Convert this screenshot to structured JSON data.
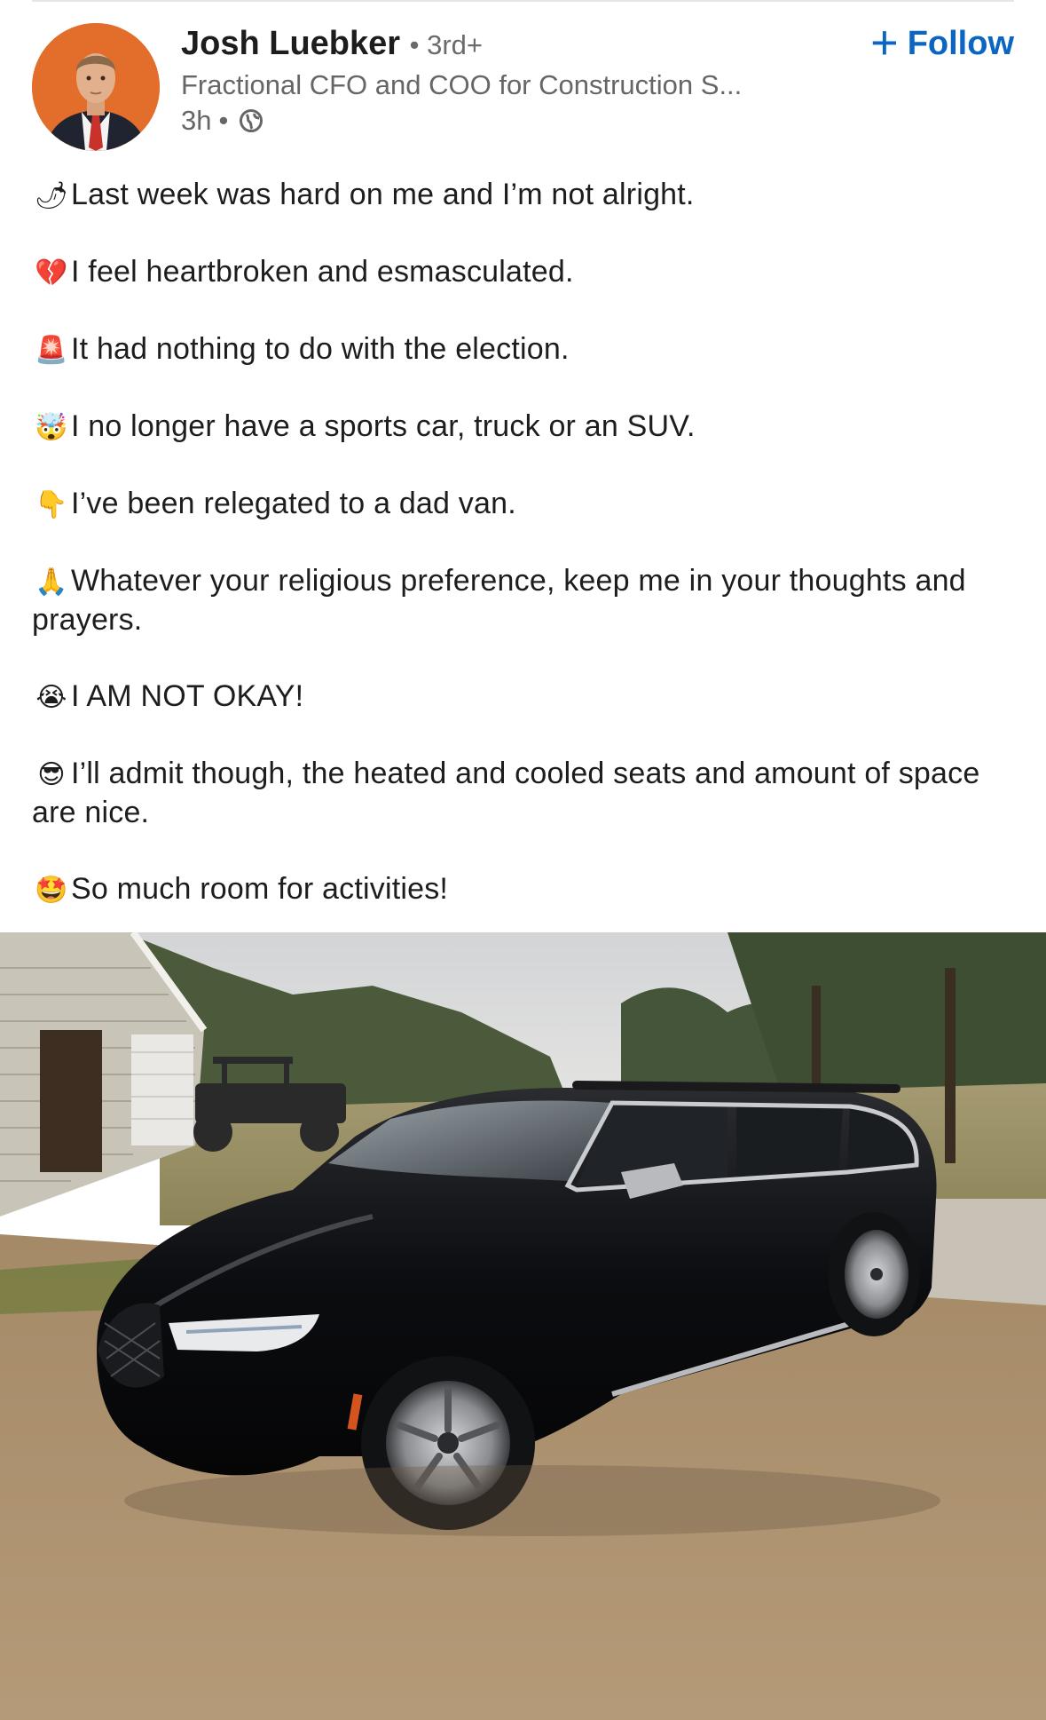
{
  "post": {
    "author": {
      "name": "Josh Luebker",
      "degree": "3rd+",
      "headline": "Fractional CFO and COO for Construction S...",
      "time": "3h",
      "avatar_icon": "profile-photo"
    },
    "follow_label": "Follow",
    "lines": [
      {
        "emoji": "🌶",
        "icon": "hot-pepper-icon",
        "text": "Last week was hard on me and I’m not alright."
      },
      {
        "emoji": "💔",
        "icon": "broken-heart-icon",
        "text": "I feel heartbroken and esmasculated."
      },
      {
        "emoji": "🚨",
        "icon": "siren-icon",
        "text": "It had nothing to do with the election."
      },
      {
        "emoji": "🤯",
        "icon": "exploding-head-icon",
        "text": "I no longer have a sports car, truck or an SUV."
      },
      {
        "emoji": "👇",
        "icon": "pointing-down-icon",
        "text": "I’ve been relegated to a dad van."
      },
      {
        "emoji": "🙏",
        "icon": "praying-hands-icon",
        "text": "Whatever your religious preference, keep me in your thoughts and prayers."
      },
      {
        "emoji": "😭",
        "icon": "crying-face-icon",
        "text": "I AM NOT OKAY!"
      },
      {
        "emoji": "😎",
        "icon": "sunglasses-face-icon",
        "text": "I’ll admit though, the heated and cooled seats and amount of space are nice."
      },
      {
        "emoji": "🤩",
        "icon": "star-struck-icon",
        "text": "So much room for activities!"
      }
    ],
    "image": "black-minivan-photo"
  },
  "colors": {
    "link_blue": "#0a66c2",
    "avatar_orange": "#e36d2a",
    "secondary_text": "#666666"
  }
}
